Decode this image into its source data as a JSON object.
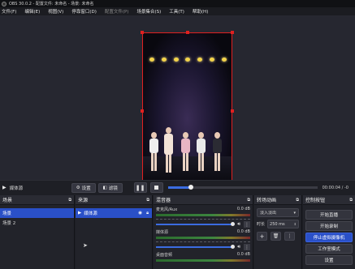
{
  "window": {
    "title": "OBS 30.0.2 - 配置文件: 未命名 - 场景: 未命名"
  },
  "menubar": {
    "items": [
      "文件(F)",
      "编辑(E)",
      "视图(V)",
      "停靠窗口(D)",
      "配置文件(P)",
      "场景集合(S)",
      "工具(T)",
      "帮助(H)"
    ]
  },
  "transport": {
    "source_name": "媒体源",
    "settings_label": "设置",
    "filters_label": "滤镜",
    "time": "00:00:04 / -0"
  },
  "scenes": {
    "title": "场景",
    "items": [
      "场景",
      "场景 2"
    ]
  },
  "sources": {
    "title": "来源",
    "items": [
      "媒体源"
    ]
  },
  "mixer": {
    "title": "混音器",
    "channels": [
      {
        "name": "麦克风/Aux",
        "db": "0.0 dB"
      },
      {
        "name": "媒体源",
        "db": "0.0 dB"
      },
      {
        "name": "桌面音频",
        "db": "0.0 dB"
      }
    ]
  },
  "transitions": {
    "title": "转场动画",
    "type": "淡入淡出",
    "duration_label": "时长",
    "duration_value": "250 ms"
  },
  "controls": {
    "title": "控制按钮",
    "buttons": [
      "开始直播",
      "开始录制",
      "停止虚拟摄像机",
      "工作室模式",
      "设置"
    ]
  },
  "colors": {
    "accent": "#2a50c8",
    "selection_border": "#e02020",
    "background": "#1e1f25"
  }
}
